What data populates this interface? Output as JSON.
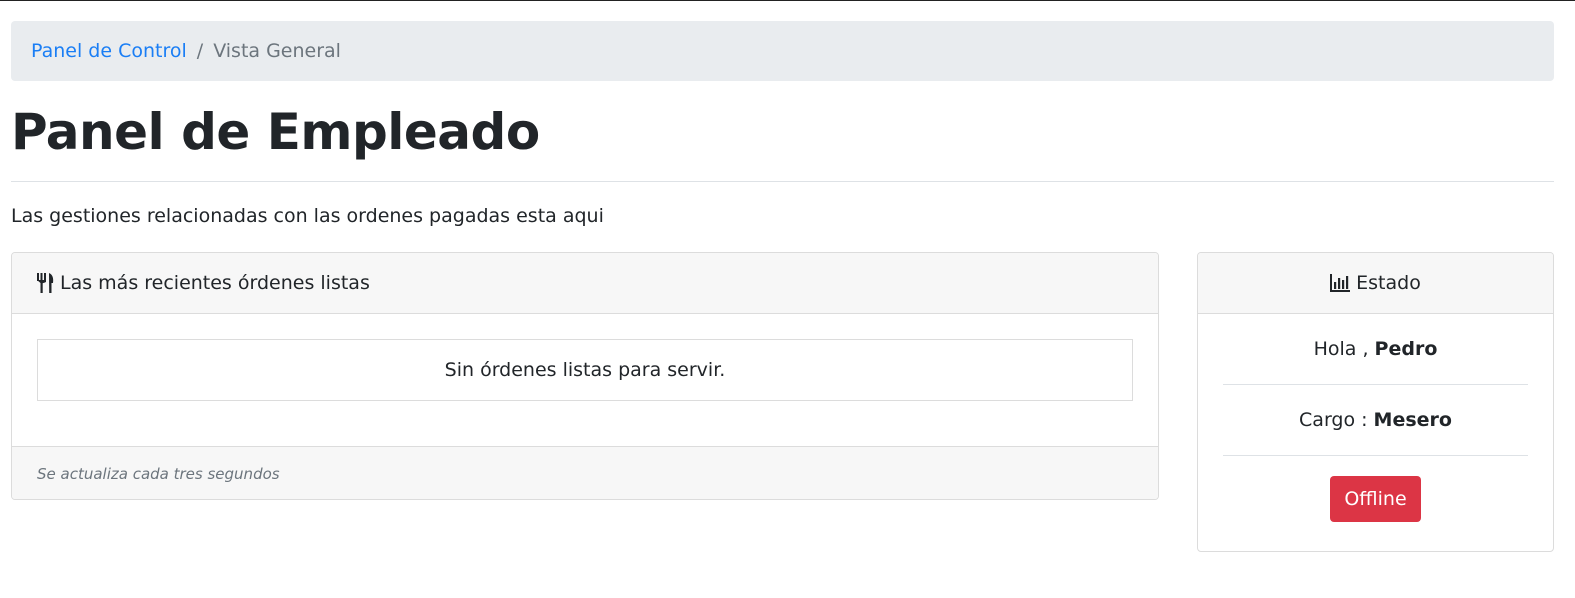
{
  "breadcrumb": {
    "items": [
      "Panel de Control",
      "Vista General"
    ],
    "separator": "/"
  },
  "page": {
    "title": "Panel de Empleado",
    "lead": "Las gestiones relacionadas con las ordenes pagadas esta aqui"
  },
  "orders_card": {
    "icon": "utensils-icon",
    "header": "Las más recientes órdenes listas",
    "empty_message": "Sin órdenes listas para servir.",
    "footer": "Se actualiza cada tres segundos"
  },
  "status_card": {
    "icon": "chart-bar-icon",
    "header": "Estado",
    "greeting_label": "Hola ,",
    "user_name": "Pedro",
    "role_label": "Cargo :",
    "role_value": "Mesero",
    "status_button": "Offline"
  },
  "colors": {
    "link": "#1a7ef5",
    "danger": "#dc3545",
    "breadcrumb_bg": "#e9ecef",
    "card_header_bg": "#f7f7f7"
  }
}
